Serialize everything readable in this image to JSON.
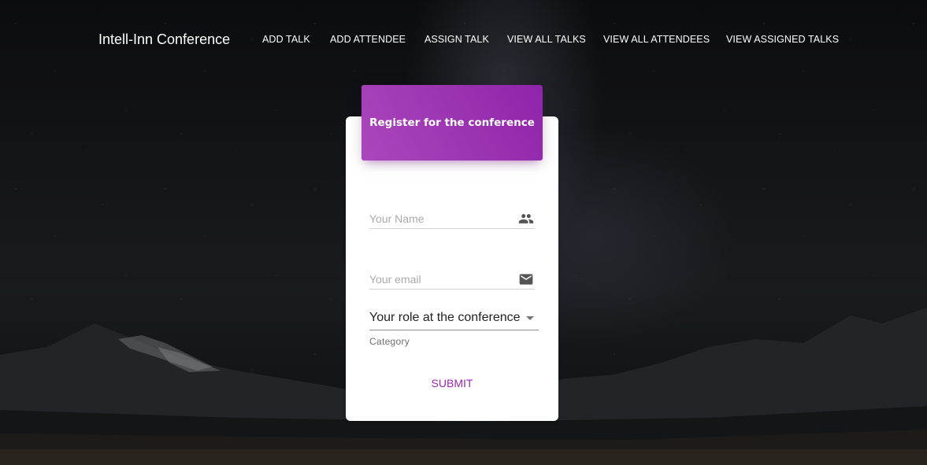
{
  "nav": {
    "brand": "Intell-Inn Conference",
    "links": [
      {
        "label": "ADD TALK"
      },
      {
        "label": "ADD ATTENDEE"
      },
      {
        "label": "ASSIGN TALK"
      },
      {
        "label": "VIEW ALL TALKS"
      },
      {
        "label": "VIEW ALL ATTENDEES"
      },
      {
        "label": "VIEW ASSIGNED TALKS"
      }
    ]
  },
  "form": {
    "title": "Register for the conference",
    "name_field": {
      "placeholder": "Your Name",
      "value": "",
      "icon": "people-icon"
    },
    "email_field": {
      "placeholder": "Your email",
      "value": "",
      "icon": "email-icon"
    },
    "role_select": {
      "selected": "Your role at the conference",
      "helper": "Category"
    },
    "submit_label": "SUBMIT"
  },
  "colors": {
    "accent": "#9c27b0",
    "header_gradient_start": "#ab47bc",
    "header_gradient_end": "#8e24aa",
    "card": "#ffffff"
  }
}
